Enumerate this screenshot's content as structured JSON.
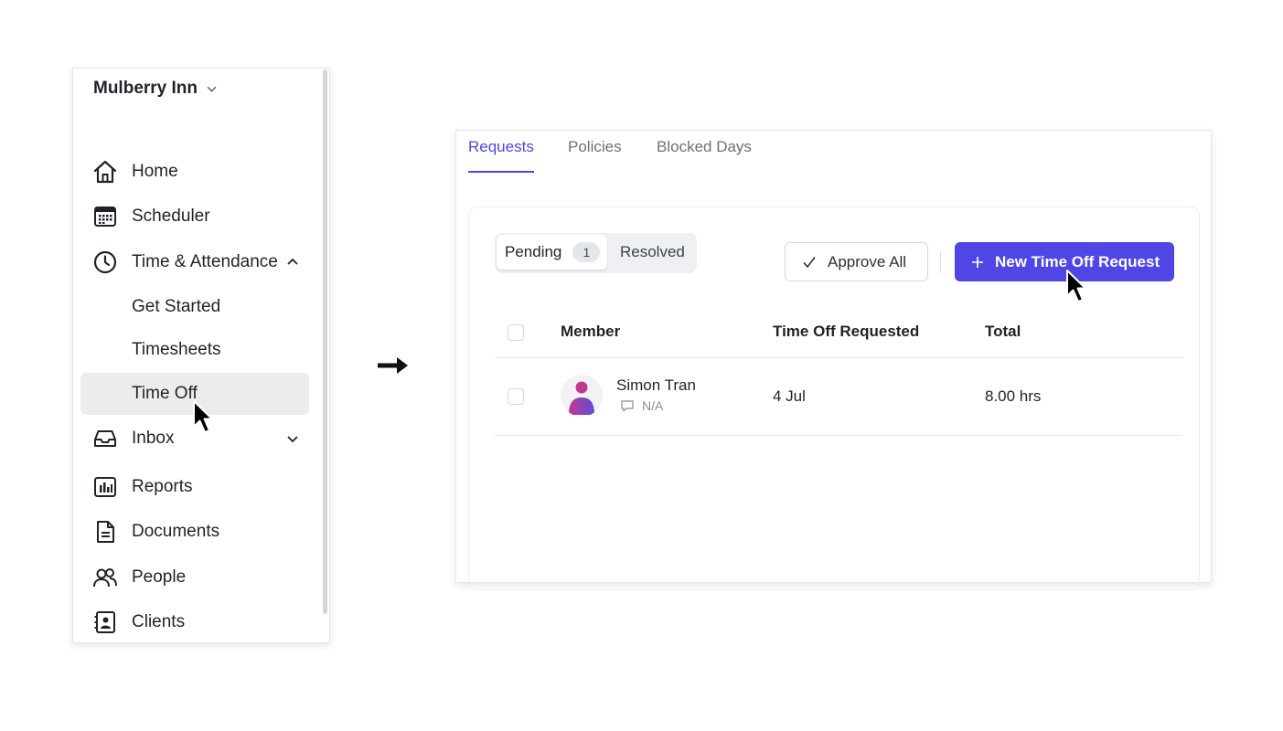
{
  "sidebar": {
    "workspace": "Mulberry Inn",
    "items": {
      "home": "Home",
      "scheduler": "Scheduler",
      "time_attendance": "Time & Attendance",
      "inbox": "Inbox",
      "reports": "Reports",
      "documents": "Documents",
      "people": "People",
      "clients": "Clients"
    },
    "sub_items": {
      "get_started": "Get Started",
      "timesheets": "Timesheets",
      "time_off": "Time Off"
    },
    "active_item": "Time Off"
  },
  "tabs": {
    "requests": "Requests",
    "policies": "Policies",
    "blocked_days": "Blocked Days",
    "active": "Requests"
  },
  "filter": {
    "pending": "Pending",
    "pending_count": "1",
    "resolved": "Resolved"
  },
  "actions": {
    "approve_all": "Approve All",
    "new_request": "New Time Off Request"
  },
  "table": {
    "headers": {
      "member": "Member",
      "time_off_requested": "Time Off Requested",
      "total": "Total"
    },
    "rows": [
      {
        "name": "Simon Tran",
        "note": "N/A",
        "date": "4 Jul",
        "total": "8.00 hrs"
      }
    ]
  },
  "colors": {
    "accent": "#4f46e5",
    "active_nav_bg": "#ececec",
    "avatar_top": "#c0398f",
    "avatar_bottom": "#5b4fd6"
  }
}
